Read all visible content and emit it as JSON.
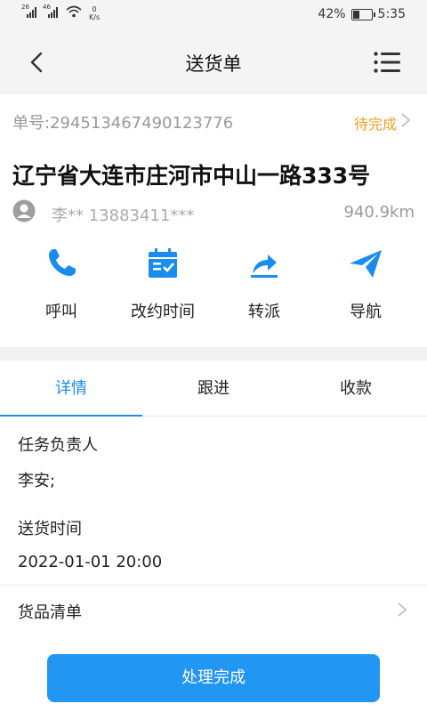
{
  "status_bar": {
    "net1": "26",
    "net2": "46",
    "speed_value": "0",
    "speed_unit": "K/s",
    "battery_text": "42%",
    "battery_level": 0.42,
    "time": "5:35"
  },
  "navbar": {
    "title": "送货单",
    "back_icon": "chevron-left-icon",
    "menu_icon": "menu-icon"
  },
  "order": {
    "number": "单号:294513467490123776",
    "status": "待完成"
  },
  "delivery": {
    "address": "辽宁省大连市庄河市中山一路333号",
    "contact": "李** 13883411***",
    "distance": "940.9km"
  },
  "actions": [
    {
      "label": "呼叫",
      "icon": "phone-icon"
    },
    {
      "label": "改约时间",
      "icon": "calendar-check-icon"
    },
    {
      "label": "转派",
      "icon": "share-icon"
    },
    {
      "label": "导航",
      "icon": "paper-plane-icon"
    }
  ],
  "tabs": [
    {
      "label": "详情",
      "active": true
    },
    {
      "label": "跟进",
      "active": false
    },
    {
      "label": "收款",
      "active": false
    }
  ],
  "details": {
    "owner_label": "任务负责人",
    "owner_value": "李安;",
    "time_label": "送货时间",
    "time_value": "2022-01-01 20:00",
    "goods_label": "货品清单"
  },
  "finish_button": "处理完成",
  "colors": {
    "accent": "#1a8cf0",
    "button": "#2196f3",
    "pending": "#f0a020"
  }
}
